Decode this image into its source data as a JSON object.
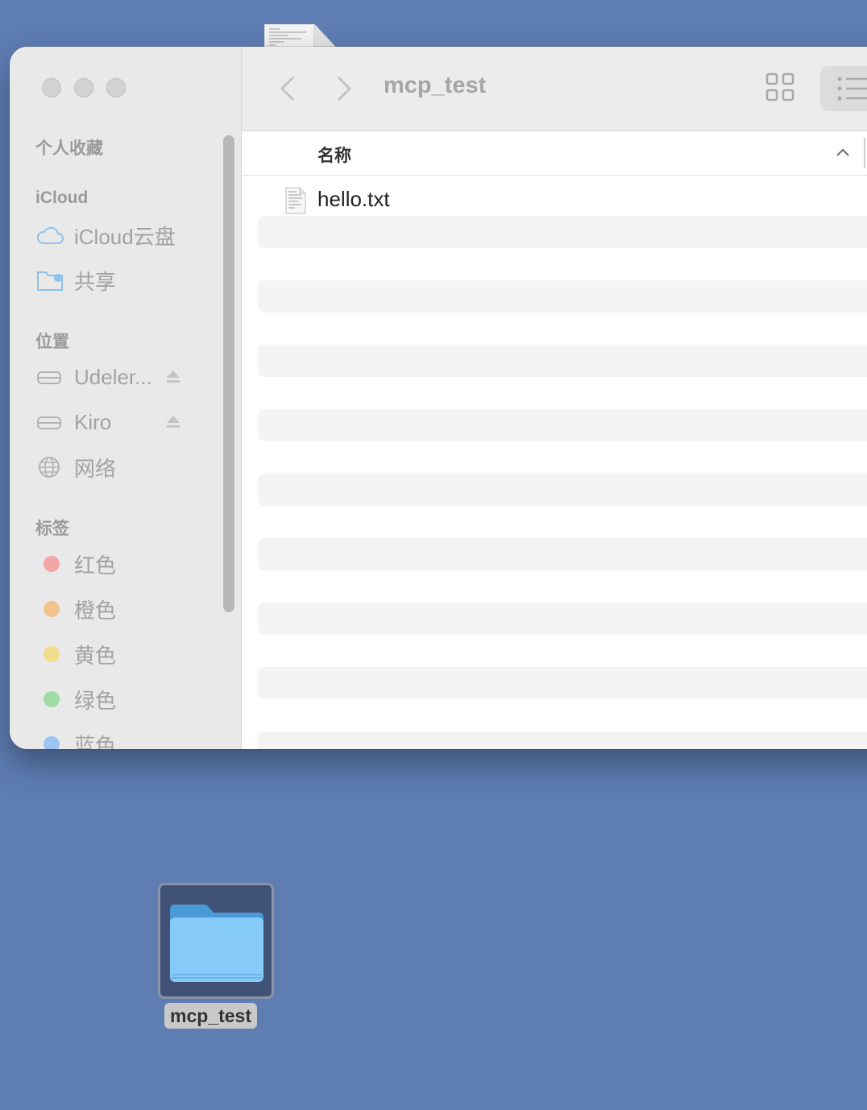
{
  "colors": {
    "desktop": "#5d7db3",
    "sidebar_bg": "#e9e9e9",
    "tag_red": "#f3a6a6",
    "tag_orange": "#f1c490",
    "tag_yellow": "#f0dc8a",
    "tag_green": "#9fdba5",
    "tag_blue": "#9dc4f3"
  },
  "window": {
    "title": "mcp_test",
    "column_header": "名称"
  },
  "sidebar": {
    "sections": {
      "favorites": "个人收藏",
      "icloud": "iCloud",
      "locations": "位置",
      "tags": "标签"
    },
    "icloud_items": [
      {
        "label": "iCloud云盘",
        "icon": "cloud-icon"
      },
      {
        "label": "共享",
        "icon": "shared-folder-icon"
      }
    ],
    "location_items": [
      {
        "label": "Udeler...",
        "icon": "drive-icon",
        "ejectable": true
      },
      {
        "label": "Kiro",
        "icon": "drive-icon",
        "ejectable": true
      },
      {
        "label": "网络",
        "icon": "globe-icon",
        "ejectable": false
      }
    ],
    "tag_items": [
      {
        "label": "红色",
        "color": "red"
      },
      {
        "label": "橙色",
        "color": "orange"
      },
      {
        "label": "黄色",
        "color": "yellow"
      },
      {
        "label": "绿色",
        "color": "green"
      },
      {
        "label": "蓝色",
        "color": "blue"
      }
    ]
  },
  "files": [
    {
      "name": "hello.txt",
      "icon": "text-file-icon"
    }
  ],
  "desktop": {
    "folder_label": "mcp_test"
  }
}
